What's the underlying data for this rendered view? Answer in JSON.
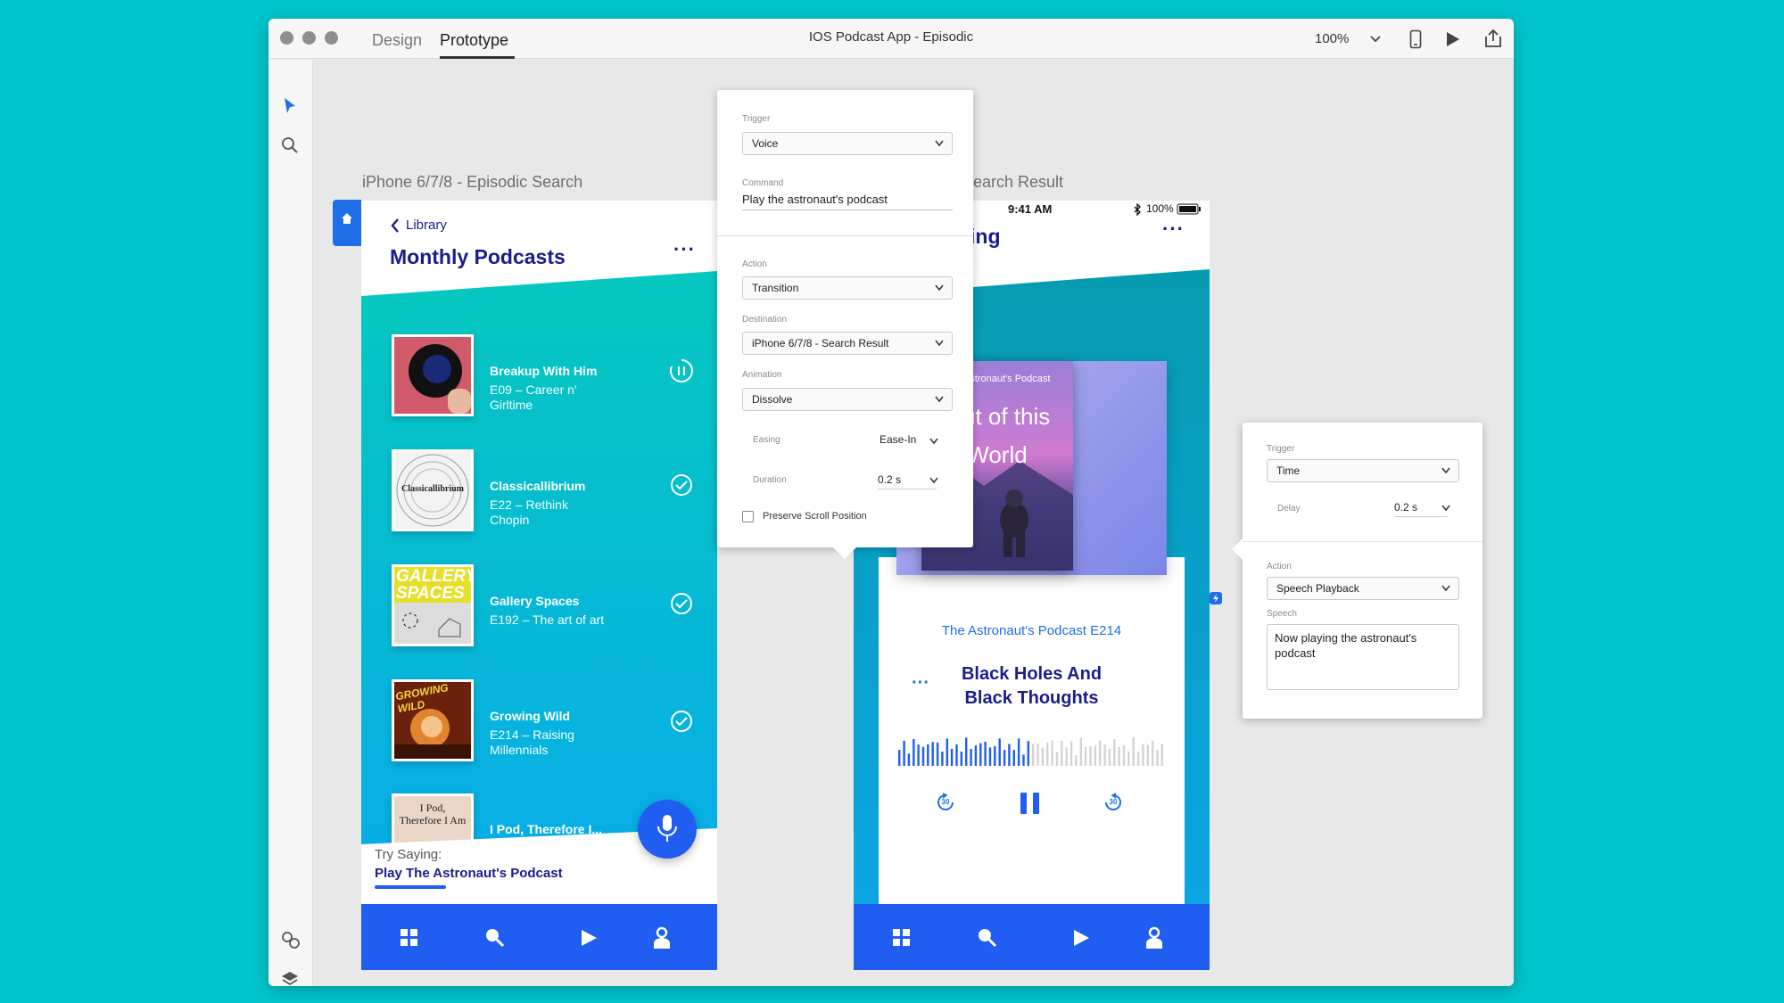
{
  "app": {
    "modes": [
      "Design",
      "Prototype"
    ],
    "active_mode": "Prototype",
    "document_title": "IOS Podcast App - Episodic",
    "zoom": "100%"
  },
  "artboards": {
    "left_label": "iPhone 6/7/8 - Episodic Search",
    "right_label_visible": "earch Result"
  },
  "phone1": {
    "back_label": "Library",
    "title": "Monthly Podcasts",
    "episodes": [
      {
        "title": "Breakup With Him",
        "subtitle_line1": "E09 – Career n'",
        "subtitle_line2": "Girltime",
        "status": "playing"
      },
      {
        "title": "Classicallibrium",
        "subtitle_line1": "E22 – Rethink",
        "subtitle_line2": "Chopin",
        "status": "done",
        "cover_text": "Classicallibrium"
      },
      {
        "title": "Gallery Spaces",
        "subtitle_line1": "E192 – The art of art",
        "subtitle_line2": "",
        "status": "done",
        "cover_text": "GALLERY SPACES"
      },
      {
        "title": "Growing Wild",
        "subtitle_line1": "E214 – Raising",
        "subtitle_line2": "Millennials",
        "status": "done",
        "cover_text": "GROWING WILD"
      },
      {
        "title": "I Pod, Therefore I...",
        "cover_text_line1": "I Pod,",
        "cover_text_line2": "Therefore I Am"
      }
    ],
    "try_saying_label": "Try Saying:",
    "try_saying_phrase": "Play The Astronaut's Podcast"
  },
  "phone2": {
    "status_time": "9:41 AM",
    "battery": "100%",
    "title_visible": "ing",
    "cover_podcast_name": "The Astronaut's Podcast",
    "cover_title_line1": "Out of this",
    "cover_title_line2": "World",
    "episode_label": "The Astronaut's Podcast E214",
    "episode_title_line1": "Black Holes And",
    "episode_title_line2": "Black Thoughts",
    "skip_seconds": "30",
    "waveform_played_fraction": 0.5
  },
  "voice_popover": {
    "trigger_label": "Trigger",
    "trigger_value": "Voice",
    "command_label": "Command",
    "command_value": "Play the astronaut's podcast",
    "action_label": "Action",
    "action_value": "Transition",
    "destination_label": "Destination",
    "destination_value": "iPhone 6/7/8 - Search Result",
    "animation_label": "Animation",
    "animation_value": "Dissolve",
    "easing_label": "Easing",
    "easing_value": "Ease-In",
    "duration_label": "Duration",
    "duration_value": "0.2 s",
    "preserve_label": "Preserve Scroll Position"
  },
  "time_popover": {
    "trigger_label": "Trigger",
    "trigger_value": "Time",
    "delay_label": "Delay",
    "delay_value": "0.2 s",
    "action_label": "Action",
    "action_value": "Speech Playback",
    "speech_label": "Speech",
    "speech_value": "Now playing the astronaut's podcast"
  },
  "colors": {
    "background": "#00c5cc",
    "navy": "#1c1c8c",
    "tab_bar": "#1f5ef0",
    "accent_blue": "#1e6ee8"
  }
}
